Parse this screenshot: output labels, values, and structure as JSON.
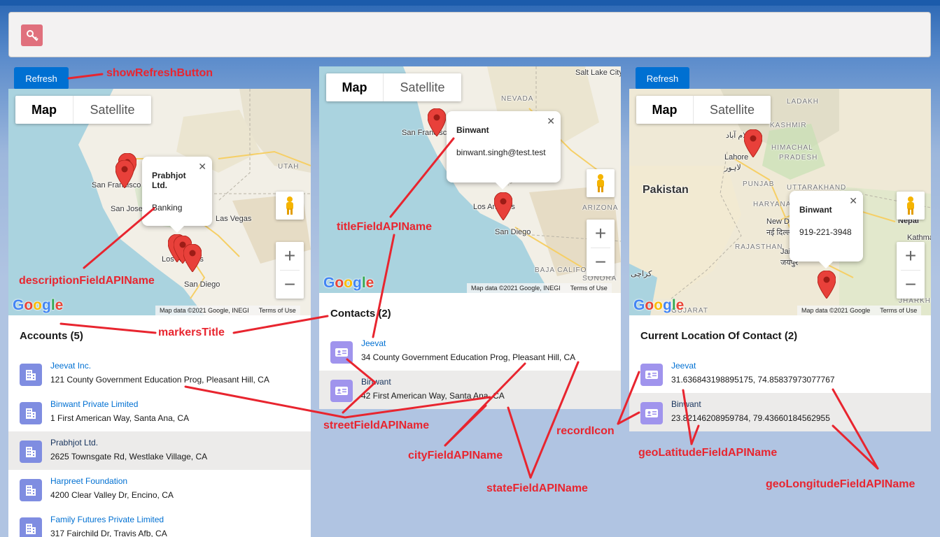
{
  "header": {
    "app_icon": "key-icon"
  },
  "refresh_label": "Refresh",
  "map_controls": {
    "map": "Map",
    "satellite": "Satellite",
    "zoom_in": "+",
    "zoom_out": "−",
    "attribution_terms": "Terms of Use"
  },
  "google_logo": "Google",
  "panel1": {
    "attribution": "Map data ©2021 Google, INEGI",
    "infowindow": {
      "title": "Prabhjot Ltd.",
      "description": "Banking"
    },
    "map_labels": {
      "sf": "San Francisco",
      "sj": "San Jose",
      "lv": "Las Vegas",
      "la": "Los Angeles",
      "sd": "San Diego",
      "utah": "UTAH"
    },
    "list_title": "Accounts (5)",
    "items": [
      {
        "name": "Jeevat Inc.",
        "address": "121 County Government Education Prog, Pleasant Hill, CA"
      },
      {
        "name": "Binwant Private Limited",
        "address": "1 First American Way, Santa Ana, CA"
      },
      {
        "name": "Prabhjot Ltd.",
        "address": "2625 Townsgate Rd, Westlake Village, CA"
      },
      {
        "name": "Harpreet Foundation",
        "address": "4200 Clear Valley Dr, Encino, CA"
      },
      {
        "name": "Family Futures Private Limited",
        "address": "317 Fairchild Dr, Travis Afb, CA"
      }
    ]
  },
  "panel2": {
    "attribution": "Map data ©2021 Google, INEGI",
    "infowindow": {
      "title": "Binwant",
      "description": "binwant.singh@test.test"
    },
    "map_labels": {
      "slc": "Salt Lake City",
      "nevada": "NEVADA",
      "sf": "San Francisc",
      "la": "Los Angeles",
      "sd": "San Diego",
      "arizona": "ARIZONA",
      "baja": "BAJA CALIFORNIA",
      "sonora": "SONORA"
    },
    "list_title": "Contacts (2)",
    "items": [
      {
        "name": "Jeevat",
        "address": "34 County Government Education Prog, Pleasant Hill, CA"
      },
      {
        "name": "Binwant",
        "address": "42 First American Way, Santa Ana, CA"
      }
    ]
  },
  "panel3": {
    "attribution": "Map data ©2021 Google",
    "infowindow": {
      "title": "Binwant",
      "description": "919-221-3948"
    },
    "map_labels": {
      "ladakh": "LADAKH",
      "kashmir": "KASHMIR",
      "lahore": "Lahore",
      "lahore_ur": "لاہور",
      "islamabad": "اسلام آباد",
      "himachal": "HIMACHAL",
      "pradesh": "PRADESH",
      "pakistan": "Pakistan",
      "punjab": "PUNJAB",
      "uttarakhand": "UTTARAKHAND",
      "haryana": "HARYANA",
      "delhi": "New Delhi",
      "delhi_hi": "नई दिल्ली",
      "nepal": "Nepal",
      "rajasthan": "RAJASTHAN",
      "jaipur": "Jaipur",
      "jaipur_hi": "जयपुर",
      "karachi": "كراچی",
      "kathmandu": "Kathmar",
      "gujarat": "GUJARAT",
      "jharkhand": "JHARKH"
    },
    "list_title": "Current Location Of Contact (2)",
    "items": [
      {
        "name": "Jeevat",
        "address": "31.636843198895175, 74.85837973077767"
      },
      {
        "name": "Binwant",
        "address": "23.82146208959784, 79.43660184562955"
      }
    ]
  },
  "annotations": {
    "showRefreshButton": "showRefreshButton",
    "titleFieldAPIName": "titleFieldAPIName",
    "descriptionFieldAPIName": "descriptionFieldAPIName",
    "markersTitle": "markersTitle",
    "streetFieldAPIName": "streetFieldAPIName",
    "cityFieldAPIName": "cityFieldAPIName",
    "stateFieldAPIName": "stateFieldAPIName",
    "recordIcon": "recordIcon",
    "geoLatitudeFieldAPIName": "geoLatitudeFieldAPIName",
    "geoLongitudeFieldAPIName": "geoLongitudeFieldAPIName"
  },
  "colors": {
    "accent": "#0070d2",
    "annotation": "#e8252f",
    "account_icon": "#7f8de1",
    "contact_icon": "#a094ed",
    "pin": "#e8403a"
  },
  "icons": {
    "account": "building-icon",
    "contact": "contact-card-icon",
    "pin": "map-pin-icon",
    "pegman": "pegman-icon"
  }
}
